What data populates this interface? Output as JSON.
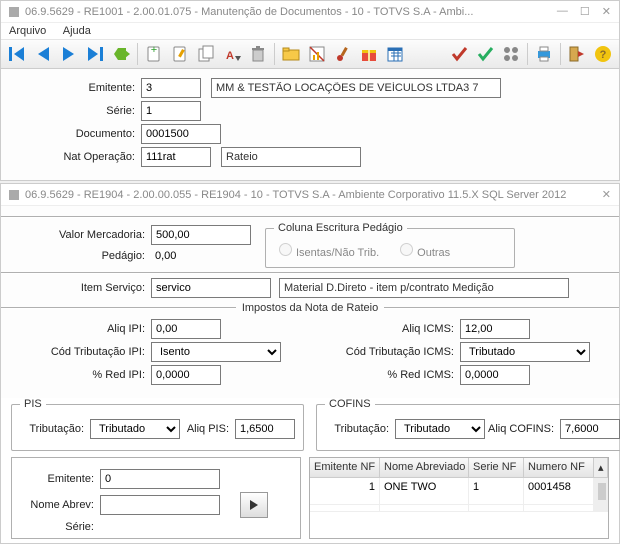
{
  "win1": {
    "title": "06.9.5629 - RE1001 - 2.00.01.075 - Manutenção de Documentos - 10 - TOTVS S.A - Ambi...",
    "menus": {
      "arquivo": "Arquivo",
      "ajuda": "Ajuda"
    }
  },
  "form1": {
    "emitente_lbl": "Emitente:",
    "emitente_val": "3",
    "emitente_desc": "MM & TESTÃO LOCAÇÕES DE VEÍCULOS LTDA3 7",
    "serie_lbl": "Série:",
    "serie_val": "1",
    "documento_lbl": "Documento:",
    "documento_val": "0001500",
    "natop_lbl": "Nat Operação:",
    "natop_val": "111rat",
    "natop_desc": "Rateio"
  },
  "win2": {
    "title": "06.9.5629 - RE1904 - 2.00.00.055 - RE1904 - 10 - TOTVS S.A - Ambiente Corporativo 11.5.X SQL Server 2012"
  },
  "form2": {
    "valor_merc_lbl": "Valor Mercadoria:",
    "valor_merc_val": "500,00",
    "pedagio_lbl": "Pedágio:",
    "pedagio_val": "0,00",
    "col_escritura_lbl": "Coluna Escritura Pedágio",
    "isentas_lbl": "Isentas/Não Trib.",
    "outras_lbl": "Outras",
    "item_serv_lbl": "Item Serviço:",
    "item_serv_val": "servico",
    "item_serv_desc": "Material D.Direto - item p/contrato Medição",
    "impostos_lbl": "Impostos da Nota de Rateio",
    "aliq_ipi_lbl": "Aliq IPI:",
    "aliq_ipi_val": "0,00",
    "trib_ipi_lbl": "Cód Tributação IPI:",
    "trib_ipi_val": "Isento",
    "red_ipi_lbl": "% Red IPI:",
    "red_ipi_val": "0,0000",
    "aliq_icms_lbl": "Aliq ICMS:",
    "aliq_icms_val": "12,00",
    "trib_icms_lbl": "Cód Tributação ICMS:",
    "trib_icms_val": "Tributado",
    "red_icms_lbl": "% Red ICMS:",
    "red_icms_val": "0,0000",
    "pis_lbl": "PIS",
    "cofins_lbl": "COFINS",
    "tributacao_lbl": "Tributação:",
    "trib_pis_val": "Tributado",
    "aliq_pis_lbl": "Aliq PIS:",
    "aliq_pis_val": "1,6500",
    "trib_cofins_val": "Tributado",
    "aliq_cofins_lbl": "Aliq COFINS:",
    "aliq_cofins_val": "7,6000",
    "emitente2_lbl": "Emitente:",
    "emitente2_val": "0",
    "nome_abrev_lbl": "Nome Abrev:",
    "nome_abrev_val": "",
    "serie2_lbl": "Série:"
  },
  "grid": {
    "h1": "Emitente NF",
    "h2": "Nome Abreviado",
    "h3": "Serie NF",
    "h4": "Numero NF",
    "r1c1": "1",
    "r1c2": "ONE TWO",
    "r1c3": "1",
    "r1c4": "0001458"
  }
}
